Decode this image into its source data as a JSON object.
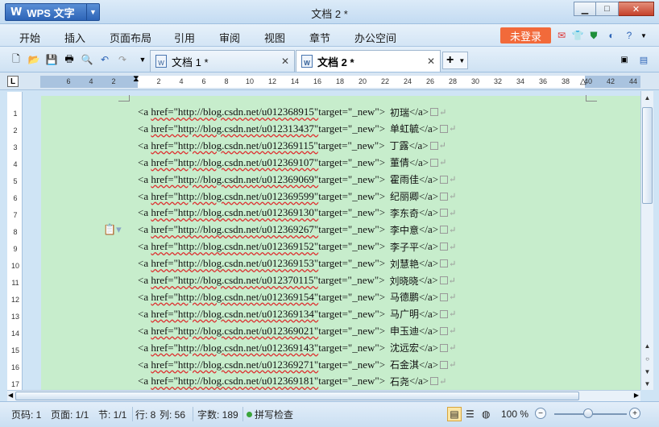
{
  "window": {
    "app_name": "WPS 文字",
    "app_logo": "W",
    "title": "文档 2 *",
    "controls": [
      "minimize",
      "maximize",
      "close"
    ]
  },
  "menu": {
    "items": [
      "开始",
      "插入",
      "页面布局",
      "引用",
      "审阅",
      "视图",
      "章节",
      "办公空间"
    ],
    "login_label": "未登录",
    "login_color": "#f26a3a"
  },
  "tabs": [
    {
      "label": "文档 1 *",
      "active": false
    },
    {
      "label": "文档 2 *",
      "active": true
    }
  ],
  "ruler": {
    "numbers": [
      "6",
      "4",
      "2",
      "2",
      "4",
      "6",
      "8",
      "10",
      "12",
      "14",
      "16",
      "18",
      "20",
      "22",
      "24",
      "26",
      "28",
      "30",
      "32",
      "34",
      "36",
      "38",
      "40",
      "42",
      "44"
    ],
    "vertical_numbers": [
      "1",
      "2",
      "3",
      "4",
      "5",
      "6",
      "7",
      "8",
      "9",
      "10",
      "11",
      "12",
      "13",
      "14",
      "15",
      "16",
      "17"
    ]
  },
  "document": {
    "lines": [
      {
        "prefix": "<a",
        "code": "href=\"http://blog.csdn.net/u012368915\"",
        "target": "target=\"_new\">",
        "name": "初瑞",
        "close": "</a>"
      },
      {
        "prefix": "<a",
        "code": "href=\"http://blog.csdn.net/u012313437\"",
        "target": "target=\"_new\">",
        "name": "单虹毓",
        "close": "</a>"
      },
      {
        "prefix": "<a",
        "code": "href=\"http://blog.csdn.net/u012369115\"",
        "target": "target=\"_new\">",
        "name": "丁露",
        "close": "</a>"
      },
      {
        "prefix": "<a",
        "code": "href=\"http://blog.csdn.net/u012369107\"",
        "target": "target=\"_new\">",
        "name": "董倩",
        "close": "</a>"
      },
      {
        "prefix": "<a",
        "code": "href=\"http://blog.csdn.net/u012369069\"",
        "target": "target=\"_new\">",
        "name": "霍雨佳",
        "close": "</a>"
      },
      {
        "prefix": "<a",
        "code": "href=\"http://blog.csdn.net/u012369599\"",
        "target": "target=\"_new\">",
        "name": "纪丽卿",
        "close": "</a>"
      },
      {
        "prefix": "<a",
        "code": "href=\"http://blog.csdn.net/u012369130\"",
        "target": "target=\"_new\">",
        "name": "李东奇",
        "close": "</a>"
      },
      {
        "prefix": "<a",
        "code": "href=\"http://blog.csdn.net/u012369267\"",
        "target": "target=\"_new\">",
        "name": "李中意",
        "close": "</a>"
      },
      {
        "prefix": "<a",
        "code": "href=\"http://blog.csdn.net/u012369152\"",
        "target": "target=\"_new\">",
        "name": "李子平",
        "close": "</a>"
      },
      {
        "prefix": "<a",
        "code": "href=\"http://blog.csdn.net/u012369153\"",
        "target": "target=\"_new\">",
        "name": "刘慧艳",
        "close": "</a>"
      },
      {
        "prefix": "<a",
        "code": "href=\"http://blog.csdn.net/u012370115\"",
        "target": "target=\"_new\">",
        "name": "刘晓晓",
        "close": "</a>"
      },
      {
        "prefix": "<a",
        "code": "href=\"http://blog.csdn.net/u012369154\"",
        "target": "target=\"_new\">",
        "name": "马德鹏",
        "close": "</a>"
      },
      {
        "prefix": "<a",
        "code": "href=\"http://blog.csdn.net/u012369134\"",
        "target": "target=\"_new\">",
        "name": "马广明",
        "close": "</a>"
      },
      {
        "prefix": "<a",
        "code": "href=\"http://blog.csdn.net/u012369021\"",
        "target": "target=\"_new\">",
        "name": "申玉迪",
        "close": "</a>"
      },
      {
        "prefix": "<a",
        "code": "href=\"http://blog.csdn.net/u012369143\"",
        "target": "target=\"_new\">",
        "name": "沈远宏",
        "close": "</a>"
      },
      {
        "prefix": "<a",
        "code": "href=\"http://blog.csdn.net/u012369271\"",
        "target": "target=\"_new\">",
        "name": "石金淇",
        "close": "</a>"
      },
      {
        "prefix": "<a",
        "code": "href=\"http://blog.csdn.net/u012369181\"",
        "target": "target=\"_new\">",
        "name": "石尧",
        "close": "</a>"
      }
    ],
    "page_color": "#c7edcc"
  },
  "status": {
    "page": "页码: 1",
    "pages": "页面: 1/1",
    "section": "节: 1/1",
    "row": "行: 8",
    "col": "列: 56",
    "words": "字数: 189",
    "spell": "拼写检查",
    "zoom": "100 %",
    "zoom_level": 1.0
  }
}
